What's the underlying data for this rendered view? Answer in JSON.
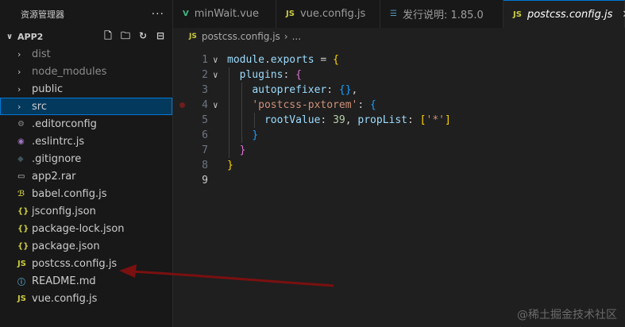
{
  "sidebar": {
    "title": "资源管理器",
    "more": "···",
    "project": "APP2",
    "items": [
      {
        "label": "dist",
        "type": "folder",
        "icon_text": "›",
        "color": "#8b8b8b"
      },
      {
        "label": "node_modules",
        "type": "folder",
        "icon_text": "›",
        "color": "#8b8b8b"
      },
      {
        "label": "public",
        "type": "folder",
        "icon_text": "›",
        "color": "#cccccc"
      },
      {
        "label": "src",
        "type": "folder",
        "icon_text": "›",
        "color": "#cccccc",
        "selected": true
      },
      {
        "label": ".editorconfig",
        "type": "file",
        "icon_text": "⚙",
        "icon_color": "#8b8b8b"
      },
      {
        "label": ".eslintrc.js",
        "type": "file",
        "icon_text": "◉",
        "icon_color": "#a074c4"
      },
      {
        "label": ".gitignore",
        "type": "file",
        "icon_text": "◆",
        "icon_color": "#41535b"
      },
      {
        "label": "app2.rar",
        "type": "file",
        "icon_text": "▭",
        "icon_color": "#cccccc"
      },
      {
        "label": "babel.config.js",
        "type": "file",
        "icon_text": "ℬ",
        "icon_color": "#cbcb41"
      },
      {
        "label": "jsconfig.json",
        "type": "file",
        "icon_text": "{}",
        "icon_color": "#cbcb41"
      },
      {
        "label": "package-lock.json",
        "type": "file",
        "icon_text": "{}",
        "icon_color": "#cbcb41"
      },
      {
        "label": "package.json",
        "type": "file",
        "icon_text": "{}",
        "icon_color": "#cbcb41"
      },
      {
        "label": "postcss.config.js",
        "type": "file",
        "icon_text": "JS",
        "icon_color": "#cbcb41"
      },
      {
        "label": "README.md",
        "type": "file",
        "icon_text": "ⓘ",
        "icon_color": "#519aba"
      },
      {
        "label": "vue.config.js",
        "type": "file",
        "icon_text": "JS",
        "icon_color": "#cbcb41"
      }
    ]
  },
  "tabs": [
    {
      "label": "minWait.vue",
      "icon_text": "V",
      "icon_color": "#41b883",
      "width": 130
    },
    {
      "label": "vue.config.js",
      "icon_text": "JS",
      "icon_color": "#cbcb41",
      "width": 131
    },
    {
      "label": "发行说明: 1.85.0",
      "icon_text": "☰",
      "icon_color": "#519aba",
      "width": 155
    },
    {
      "label": "postcss.config.js",
      "icon_text": "JS",
      "icon_color": "#cbcb41",
      "active": true,
      "close": "✕",
      "width": 153
    }
  ],
  "breadcrumb": {
    "icon_text": "JS",
    "file": "postcss.config.js",
    "sep": "›",
    "rest": "..."
  },
  "editor": {
    "lines": [
      {
        "num": "1",
        "fold": "∨",
        "tokens": [
          [
            "k",
            "module"
          ],
          [
            "w",
            "."
          ],
          [
            "k",
            "exports"
          ],
          [
            "w",
            " = "
          ],
          [
            "y",
            "{"
          ]
        ]
      },
      {
        "num": "2",
        "fold": "∨",
        "tokens": [
          [
            "w",
            "  "
          ],
          [
            "k",
            "plugins"
          ],
          [
            "w",
            ": "
          ],
          [
            "p",
            "{"
          ]
        ]
      },
      {
        "num": "3",
        "fold": "",
        "tokens": [
          [
            "w",
            "    "
          ],
          [
            "k",
            "autoprefixer"
          ],
          [
            "w",
            ": "
          ],
          [
            "b",
            "{}"
          ],
          [
            "w",
            ","
          ]
        ]
      },
      {
        "num": "4",
        "fold": "∨",
        "tokens": [
          [
            "w",
            "    "
          ],
          [
            "s",
            "'postcss-pxtorem'"
          ],
          [
            "w",
            ": "
          ],
          [
            "b",
            "{"
          ]
        ]
      },
      {
        "num": "5",
        "fold": "",
        "tokens": [
          [
            "w",
            "      "
          ],
          [
            "k",
            "rootValue"
          ],
          [
            "w",
            ": "
          ],
          [
            "n",
            "39"
          ],
          [
            "w",
            ", "
          ],
          [
            "k",
            "propList"
          ],
          [
            "w",
            ": "
          ],
          [
            "y",
            "["
          ],
          [
            "s",
            "'*'"
          ],
          [
            "y",
            "]"
          ]
        ]
      },
      {
        "num": "6",
        "fold": "",
        "tokens": [
          [
            "w",
            "    "
          ],
          [
            "b",
            "}"
          ]
        ]
      },
      {
        "num": "7",
        "fold": "",
        "tokens": [
          [
            "w",
            "  "
          ],
          [
            "p",
            "}"
          ]
        ]
      },
      {
        "num": "8",
        "fold": "",
        "tokens": [
          [
            "y",
            "}"
          ]
        ]
      },
      {
        "num": "9",
        "fold": "",
        "tokens": []
      }
    ]
  },
  "watermark": "@稀土掘金技术社区"
}
